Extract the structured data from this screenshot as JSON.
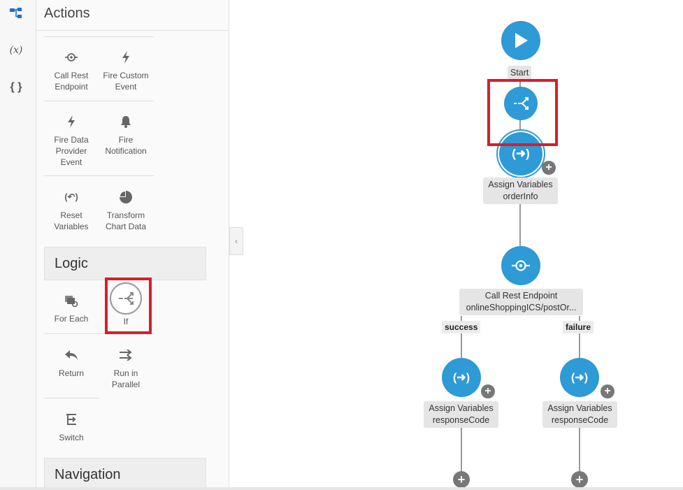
{
  "rail": {
    "items": [
      {
        "icon": "flow-icon",
        "active": true
      },
      {
        "icon": "variables-icon",
        "text": "(x)"
      },
      {
        "icon": "json-braces-icon",
        "text": "{ }"
      }
    ]
  },
  "panel": {
    "title": "Actions",
    "tiles": {
      "call_rest": "Call Rest\nEndpoint",
      "fire_custom": "Fire Custom\nEvent",
      "fire_dp": "Fire Data\nProvider\nEvent",
      "fire_notif": "Fire\nNotification",
      "reset_vars": "Reset\nVariables",
      "transform_chart": "Transform\nChart Data",
      "for_each": "For Each",
      "if": "If",
      "return": "Return",
      "run_parallel": "Run in\nParallel",
      "switch": "Switch"
    },
    "sections": {
      "logic": "Logic",
      "navigation": "Navigation"
    }
  },
  "flow": {
    "start_label": "Start",
    "assign_order": "Assign Variables\norderInfo",
    "call_rest": "Call Rest Endpoint\nonlineShoppingICS/postOr...",
    "success_label": "success",
    "failure_label": "failure",
    "assign_success": "Assign Variables\nresponseCode",
    "assign_failure": "Assign Variables\nresponseCode"
  },
  "colors": {
    "node": "#2e9ad6",
    "highlight": "#d4202a",
    "accent": "#1a73c8"
  }
}
